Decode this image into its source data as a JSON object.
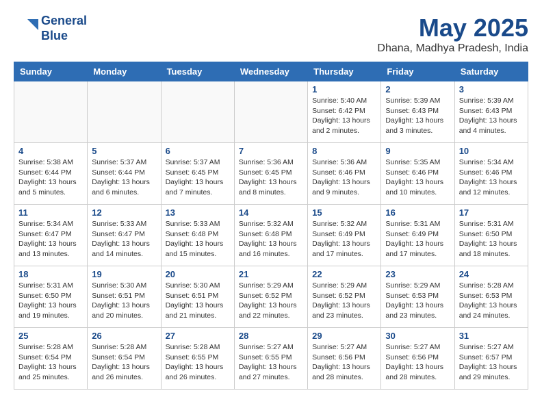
{
  "header": {
    "logo_line1": "General",
    "logo_line2": "Blue",
    "month_year": "May 2025",
    "location": "Dhana, Madhya Pradesh, India"
  },
  "days_of_week": [
    "Sunday",
    "Monday",
    "Tuesday",
    "Wednesday",
    "Thursday",
    "Friday",
    "Saturday"
  ],
  "weeks": [
    [
      {
        "day": "",
        "info": ""
      },
      {
        "day": "",
        "info": ""
      },
      {
        "day": "",
        "info": ""
      },
      {
        "day": "",
        "info": ""
      },
      {
        "day": "1",
        "info": "Sunrise: 5:40 AM\nSunset: 6:42 PM\nDaylight: 13 hours\nand 2 minutes."
      },
      {
        "day": "2",
        "info": "Sunrise: 5:39 AM\nSunset: 6:43 PM\nDaylight: 13 hours\nand 3 minutes."
      },
      {
        "day": "3",
        "info": "Sunrise: 5:39 AM\nSunset: 6:43 PM\nDaylight: 13 hours\nand 4 minutes."
      }
    ],
    [
      {
        "day": "4",
        "info": "Sunrise: 5:38 AM\nSunset: 6:44 PM\nDaylight: 13 hours\nand 5 minutes."
      },
      {
        "day": "5",
        "info": "Sunrise: 5:37 AM\nSunset: 6:44 PM\nDaylight: 13 hours\nand 6 minutes."
      },
      {
        "day": "6",
        "info": "Sunrise: 5:37 AM\nSunset: 6:45 PM\nDaylight: 13 hours\nand 7 minutes."
      },
      {
        "day": "7",
        "info": "Sunrise: 5:36 AM\nSunset: 6:45 PM\nDaylight: 13 hours\nand 8 minutes."
      },
      {
        "day": "8",
        "info": "Sunrise: 5:36 AM\nSunset: 6:46 PM\nDaylight: 13 hours\nand 9 minutes."
      },
      {
        "day": "9",
        "info": "Sunrise: 5:35 AM\nSunset: 6:46 PM\nDaylight: 13 hours\nand 10 minutes."
      },
      {
        "day": "10",
        "info": "Sunrise: 5:34 AM\nSunset: 6:46 PM\nDaylight: 13 hours\nand 12 minutes."
      }
    ],
    [
      {
        "day": "11",
        "info": "Sunrise: 5:34 AM\nSunset: 6:47 PM\nDaylight: 13 hours\nand 13 minutes."
      },
      {
        "day": "12",
        "info": "Sunrise: 5:33 AM\nSunset: 6:47 PM\nDaylight: 13 hours\nand 14 minutes."
      },
      {
        "day": "13",
        "info": "Sunrise: 5:33 AM\nSunset: 6:48 PM\nDaylight: 13 hours\nand 15 minutes."
      },
      {
        "day": "14",
        "info": "Sunrise: 5:32 AM\nSunset: 6:48 PM\nDaylight: 13 hours\nand 16 minutes."
      },
      {
        "day": "15",
        "info": "Sunrise: 5:32 AM\nSunset: 6:49 PM\nDaylight: 13 hours\nand 17 minutes."
      },
      {
        "day": "16",
        "info": "Sunrise: 5:31 AM\nSunset: 6:49 PM\nDaylight: 13 hours\nand 17 minutes."
      },
      {
        "day": "17",
        "info": "Sunrise: 5:31 AM\nSunset: 6:50 PM\nDaylight: 13 hours\nand 18 minutes."
      }
    ],
    [
      {
        "day": "18",
        "info": "Sunrise: 5:31 AM\nSunset: 6:50 PM\nDaylight: 13 hours\nand 19 minutes."
      },
      {
        "day": "19",
        "info": "Sunrise: 5:30 AM\nSunset: 6:51 PM\nDaylight: 13 hours\nand 20 minutes."
      },
      {
        "day": "20",
        "info": "Sunrise: 5:30 AM\nSunset: 6:51 PM\nDaylight: 13 hours\nand 21 minutes."
      },
      {
        "day": "21",
        "info": "Sunrise: 5:29 AM\nSunset: 6:52 PM\nDaylight: 13 hours\nand 22 minutes."
      },
      {
        "day": "22",
        "info": "Sunrise: 5:29 AM\nSunset: 6:52 PM\nDaylight: 13 hours\nand 23 minutes."
      },
      {
        "day": "23",
        "info": "Sunrise: 5:29 AM\nSunset: 6:53 PM\nDaylight: 13 hours\nand 23 minutes."
      },
      {
        "day": "24",
        "info": "Sunrise: 5:28 AM\nSunset: 6:53 PM\nDaylight: 13 hours\nand 24 minutes."
      }
    ],
    [
      {
        "day": "25",
        "info": "Sunrise: 5:28 AM\nSunset: 6:54 PM\nDaylight: 13 hours\nand 25 minutes."
      },
      {
        "day": "26",
        "info": "Sunrise: 5:28 AM\nSunset: 6:54 PM\nDaylight: 13 hours\nand 26 minutes."
      },
      {
        "day": "27",
        "info": "Sunrise: 5:28 AM\nSunset: 6:55 PM\nDaylight: 13 hours\nand 26 minutes."
      },
      {
        "day": "28",
        "info": "Sunrise: 5:27 AM\nSunset: 6:55 PM\nDaylight: 13 hours\nand 27 minutes."
      },
      {
        "day": "29",
        "info": "Sunrise: 5:27 AM\nSunset: 6:56 PM\nDaylight: 13 hours\nand 28 minutes."
      },
      {
        "day": "30",
        "info": "Sunrise: 5:27 AM\nSunset: 6:56 PM\nDaylight: 13 hours\nand 28 minutes."
      },
      {
        "day": "31",
        "info": "Sunrise: 5:27 AM\nSunset: 6:57 PM\nDaylight: 13 hours\nand 29 minutes."
      }
    ]
  ]
}
